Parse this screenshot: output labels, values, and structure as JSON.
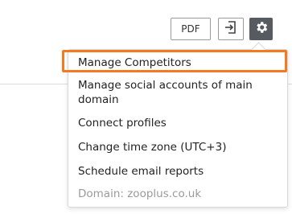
{
  "toolbar": {
    "pdf_label": "PDF",
    "export_icon": "export-icon",
    "settings_icon": "gear-icon"
  },
  "menu": {
    "items": [
      {
        "label": "Manage Competitors"
      },
      {
        "label": "Manage social accounts of main domain"
      },
      {
        "label": "Connect profiles"
      },
      {
        "label": "Change time zone (UTC+3)"
      },
      {
        "label": "Schedule email reports"
      },
      {
        "label": "Domain: zooplus.co.uk"
      }
    ]
  },
  "colors": {
    "highlight": "#f47a20",
    "settings_button_bg": "#555b60",
    "muted_text": "#9a9a9a"
  }
}
